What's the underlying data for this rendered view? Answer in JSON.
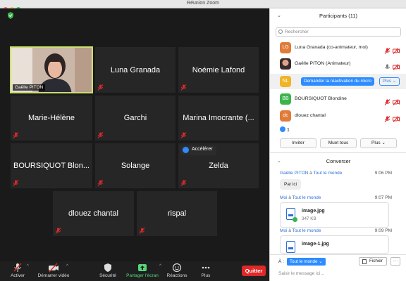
{
  "window": {
    "title": "Réunion Zoom"
  },
  "tiles": [
    {
      "name": "Gaëlle PITON"
    },
    {
      "name": "Luna Granada"
    },
    {
      "name": "Noémie Lafond"
    },
    {
      "name": "Marie-Hélène"
    },
    {
      "name": "Garchi"
    },
    {
      "name": "Marina Imocrante (..."
    },
    {
      "name": "BOURSIQUOT Blon..."
    },
    {
      "name": "Solange"
    },
    {
      "name": "Zelda"
    },
    {
      "name": "dlouez chantal"
    },
    {
      "name": "rispal"
    }
  ],
  "accelerate_label": "Accélérer",
  "toolbar": {
    "activate": "Activer",
    "start_video": "Démarrer vidéo",
    "security": "Sécurité",
    "share_screen": "Partager l'écran",
    "reactions": "Réactions",
    "more": "Plus",
    "quit": "Quitter",
    "share_color": "#55d67a",
    "quit_color": "#e02828"
  },
  "participants": {
    "header": "Participants (11)",
    "search_placeholder": "Rechercher",
    "list": [
      {
        "initials": "LG",
        "name": "Luna Granada (co-animateur, moi)",
        "color": "#e07b3a"
      },
      {
        "initials": "",
        "name": "Gaëlle PITON (Animateur)",
        "color": ""
      },
      {
        "initials": "NL",
        "name": "",
        "color": "#f0b429"
      },
      {
        "initials": "BB",
        "name": "BOURSIQUOT Blondine",
        "color": "#3bb54a"
      },
      {
        "initials": "dc",
        "name": "dlouez chantal",
        "color": "#e07b3a"
      }
    ],
    "unmute_request": "Demander la réactivation du micro",
    "row_more": "Plus",
    "raised_count": "1",
    "invite": "Inviter",
    "mute_all": "Muet tous",
    "more": "Plus"
  },
  "chat": {
    "header": "Converser",
    "to_word": "à",
    "messages": [
      {
        "from": "Gaëlle PITON",
        "to": "Tout le monde",
        "time": "9:06 PM",
        "text": "Par ici"
      },
      {
        "from": "Moi",
        "to": "Tout le monde",
        "time": "9:07 PM",
        "file": "image.jpg",
        "size": "347 KB"
      },
      {
        "from": "Moi",
        "to": "Tout le monde",
        "time": "9:09 PM",
        "file": "image-1.jpg"
      }
    ],
    "recipient_label": "À :",
    "recipient": "Tout le monde",
    "file_button": "Fichier",
    "more_button": "···",
    "input_placeholder": "Saisir le message ici…"
  }
}
